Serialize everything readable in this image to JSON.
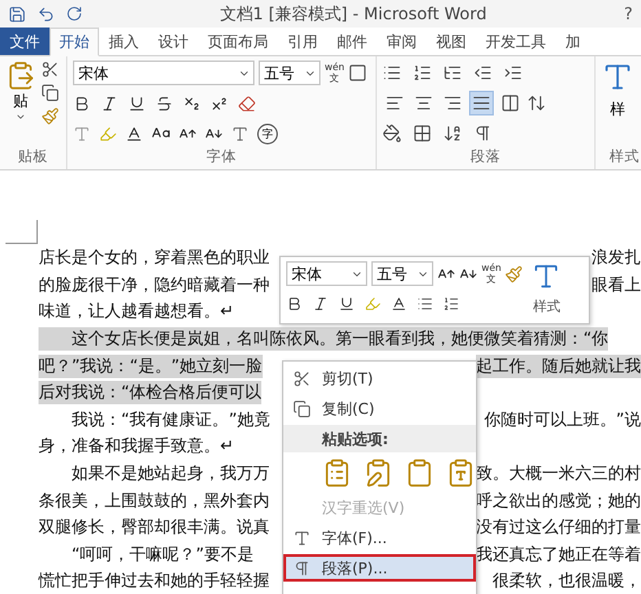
{
  "window": {
    "title": "文档1 [兼容模式] - Microsoft Word",
    "help": "?"
  },
  "tabs": [
    {
      "label": "文件",
      "kind": "file",
      "selected": false
    },
    {
      "label": "开始",
      "kind": "tab",
      "selected": true
    },
    {
      "label": "插入",
      "kind": "tab",
      "selected": false
    },
    {
      "label": "设计",
      "kind": "tab",
      "selected": false
    },
    {
      "label": "页面布局",
      "kind": "tab",
      "selected": false
    },
    {
      "label": "引用",
      "kind": "tab",
      "selected": false
    },
    {
      "label": "邮件",
      "kind": "tab",
      "selected": false
    },
    {
      "label": "审阅",
      "kind": "tab",
      "selected": false
    },
    {
      "label": "视图",
      "kind": "tab",
      "selected": false
    },
    {
      "label": "开发工具",
      "kind": "tab",
      "selected": false
    },
    {
      "label": "加",
      "kind": "tab",
      "selected": false
    }
  ],
  "ribbon": {
    "clipboard": {
      "paste_label": "贴",
      "label": "贴板"
    },
    "font": {
      "font_name": "宋体",
      "font_size": "五号",
      "phonetic_top": "wén",
      "phonetic_bottom": "文",
      "enclosed": "字",
      "label": "字体"
    },
    "paragraph": {
      "label": "段落",
      "alignment": [
        {
          "kind": "left",
          "selected": false
        },
        {
          "kind": "center",
          "selected": false
        },
        {
          "kind": "right",
          "selected": false
        },
        {
          "kind": "justify",
          "selected": true
        },
        {
          "kind": "distributed",
          "selected": false
        }
      ]
    },
    "styles": {
      "button_label": "样",
      "label": "样式"
    }
  },
  "document": {
    "lines": [
      {
        "text": "店长是个女的，穿着黑色的职业",
        "right": "浪发扎",
        "indent": false,
        "selected": false
      },
      {
        "text": "的脸庞很干净，隐约暗藏着一种",
        "right": "眼看上",
        "indent": false,
        "selected": false
      },
      {
        "text": "味道，让人越看越想看。↵",
        "indent": false,
        "selected": false
      },
      {
        "text": "这个女店长便是岚姐，名叫陈依风。第一眼看到我，她便微笑着猜测：“你",
        "indent": true,
        "selected": true
      },
      {
        "text": "吧？”我说：“是。”她立刻一脸",
        "right": "起工作。随后她就让我",
        "indent": false,
        "selected": true
      },
      {
        "text": "后对我说：“体检合格后便可以",
        "indent": false,
        "selected": true
      },
      {
        "text": "我说：“我有健康证。”她竟",
        "right": "你随时可以上班。”说",
        "indent": true,
        "selected": false
      },
      {
        "text": "身，准备和我握手致意。↵",
        "indent": false,
        "selected": false
      },
      {
        "text": "如果不是她站起身，我万万",
        "right": "致。大概一米六三的村",
        "indent": true,
        "selected": false
      },
      {
        "text": "条很美，上围鼓鼓的，黑外套内",
        "right": "呼之欲出的感觉；她的",
        "indent": false,
        "selected": false
      },
      {
        "text": "双腿修长，臀部却很丰满。说真",
        "right": "没有过这么仔细的打量",
        "indent": false,
        "selected": false
      },
      {
        "text": "“呵呵，干嘛呢？”要不是",
        "right": "我还真忘了她正在等着",
        "indent": true,
        "selected": false
      },
      {
        "text": "慌忙把手伸过去和她的手轻轻握",
        "right": "很柔软，也很温暖，",
        "indent": false,
        "selected": false
      }
    ]
  },
  "mini_toolbar": {
    "font_name": "宋体",
    "font_size": "五号",
    "phonetic_top": "wén",
    "phonetic_bottom": "文",
    "styles_label": "样式"
  },
  "context_menu": [
    {
      "kind": "item",
      "label": "剪切(T)",
      "disabled": false,
      "selected": false,
      "outlined": false
    },
    {
      "kind": "item",
      "label": "复制(C)",
      "disabled": false,
      "selected": false,
      "outlined": false
    },
    {
      "kind": "header",
      "label": "粘贴选项:"
    },
    {
      "kind": "paste_options"
    },
    {
      "kind": "item",
      "label": "汉字重选(V)",
      "disabled": true,
      "selected": false,
      "outlined": false
    },
    {
      "kind": "item",
      "label": "字体(F)...",
      "disabled": false,
      "selected": false,
      "outlined": false
    },
    {
      "kind": "item",
      "label": "段落(P)...",
      "disabled": false,
      "selected": true,
      "outlined": true
    }
  ]
}
